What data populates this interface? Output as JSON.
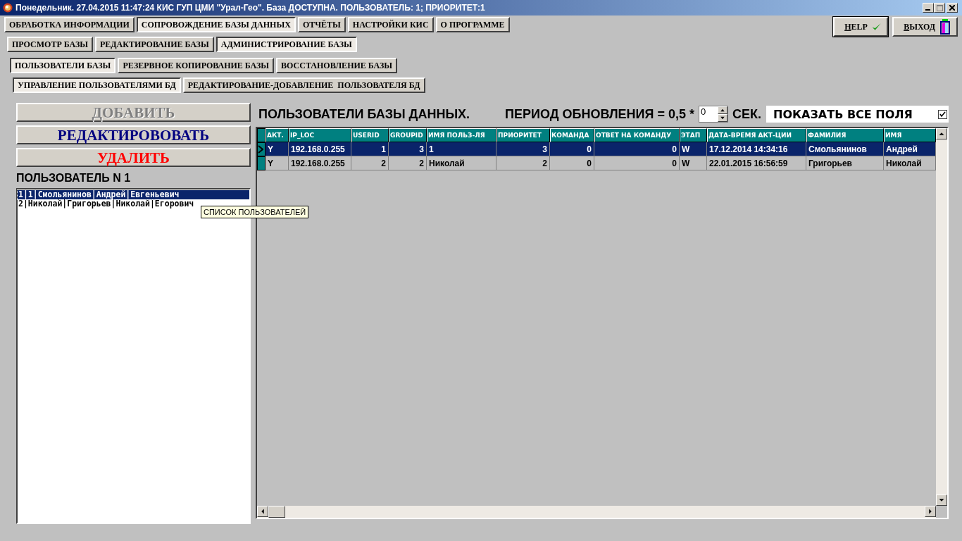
{
  "window": {
    "title": "Понедельник. 27.04.2015 11:47:24 КИС ГУП ЦМИ \"Урал-Гео\". База ДОСТУПНА. ПОЛЬЗОВАТЕЛЬ: 1; ПРИОРИТЕТ:1"
  },
  "tab_rows": [
    [
      {
        "label": "ОБРАБОТКА ИНФОРМАЦИИ",
        "selected": false
      },
      {
        "label": "СОПРОВОЖДЕНИЕ БАЗЫ ДАННЫХ",
        "selected": true
      },
      {
        "label": "ОТЧЁТЫ",
        "selected": false
      },
      {
        "label": "НАСТРОЙКИ КИС",
        "selected": false
      },
      {
        "label": "О ПРОГРАММЕ",
        "selected": false
      }
    ],
    [
      {
        "label": "ПРОСМОТР БАЗЫ",
        "selected": false
      },
      {
        "label": "РЕДАКТИРОВАНИЕ БАЗЫ",
        "selected": false
      },
      {
        "label": "АДМИНИСТРИРОВАНИЕ БАЗЫ",
        "selected": true
      }
    ],
    [
      {
        "label": "ПОЛЬЗОВАТЕЛИ БАЗЫ",
        "selected": true
      },
      {
        "label": "РЕЗЕРВНОЕ КОПИРОВАНИЕ БАЗЫ",
        "selected": false
      },
      {
        "label": "ВОССТАНОВЛЕНИЕ БАЗЫ",
        "selected": false
      }
    ],
    [
      {
        "label": "УПРАВЛЕНИЕ ПОЛЬЗОВАТЕЛЯМИ БД",
        "selected": true
      },
      {
        "label": "РЕДАКТИРОВАНИЕ-ДОБАВЛЕНИЕ  ПОЛЬЗОВАТЕЛЯ БД",
        "selected": false
      }
    ]
  ],
  "top_buttons": [
    {
      "label": "HELP",
      "kind": "help"
    },
    {
      "label": "ВЫХОД",
      "kind": "exit"
    }
  ],
  "actions": [
    {
      "label": "ДОБАВИТЬ",
      "disabled": true,
      "color": "#808080"
    },
    {
      "label": "РЕДАКТИРОВОВАТЬ",
      "disabled": false,
      "color": "#000080"
    },
    {
      "label": "УДАЛИТЬ",
      "disabled": false,
      "color": "#ff0000"
    }
  ],
  "user_label": "ПОЛЬЗОВАТЕЛЬ N 1",
  "user_list": [
    {
      "text": "1|1|Смольянинов|Андрей|Евгеньевич",
      "selected": true
    },
    {
      "text": "2|Николай|Григорьев|Николай|Егорович",
      "selected": false
    }
  ],
  "tooltip": "СПИСОК ПОЛЬЗОВАТЕЛЕЙ",
  "grid_title": "ПОЛЬЗОВАТЕЛИ БАЗЫ ДАННЫХ.",
  "period": {
    "label": "ПЕРИОД ОБНОВЛЕНИЯ = 0,5 *",
    "value": "0",
    "unit": "СЕК."
  },
  "show_all": {
    "label": "ПОКАЗАТЬ ВСЕ ПОЛЯ",
    "checked": true
  },
  "table": {
    "columns": [
      "АКТ.",
      "IP_LOC",
      "USERID",
      "GROUPID",
      "ИМЯ ПОЛЬЗ-ЛЯ",
      "ПРИОРИТЕТ",
      "КОМАНДА",
      "ОТВЕТ НА КОМАНДУ",
      "ЭТАП",
      "ДАТА-ВРЕМЯ АКТ-ЦИИ",
      "ФАМИЛИЯ",
      "ИМЯ"
    ],
    "rows": [
      {
        "selected": true,
        "cells": [
          "Y",
          "192.168.0.255",
          "1",
          "3",
          "1",
          "3",
          "0",
          "0",
          "W",
          "17.12.2014 14:34:16",
          "Смольянинов",
          "Андрей"
        ]
      },
      {
        "selected": false,
        "cells": [
          "Y",
          "192.168.0.255",
          "2",
          "2",
          "Николай",
          "2",
          "0",
          "0",
          "W",
          "22.01.2015 16:56:59",
          "Григорьев",
          "Николай"
        ]
      }
    ]
  }
}
